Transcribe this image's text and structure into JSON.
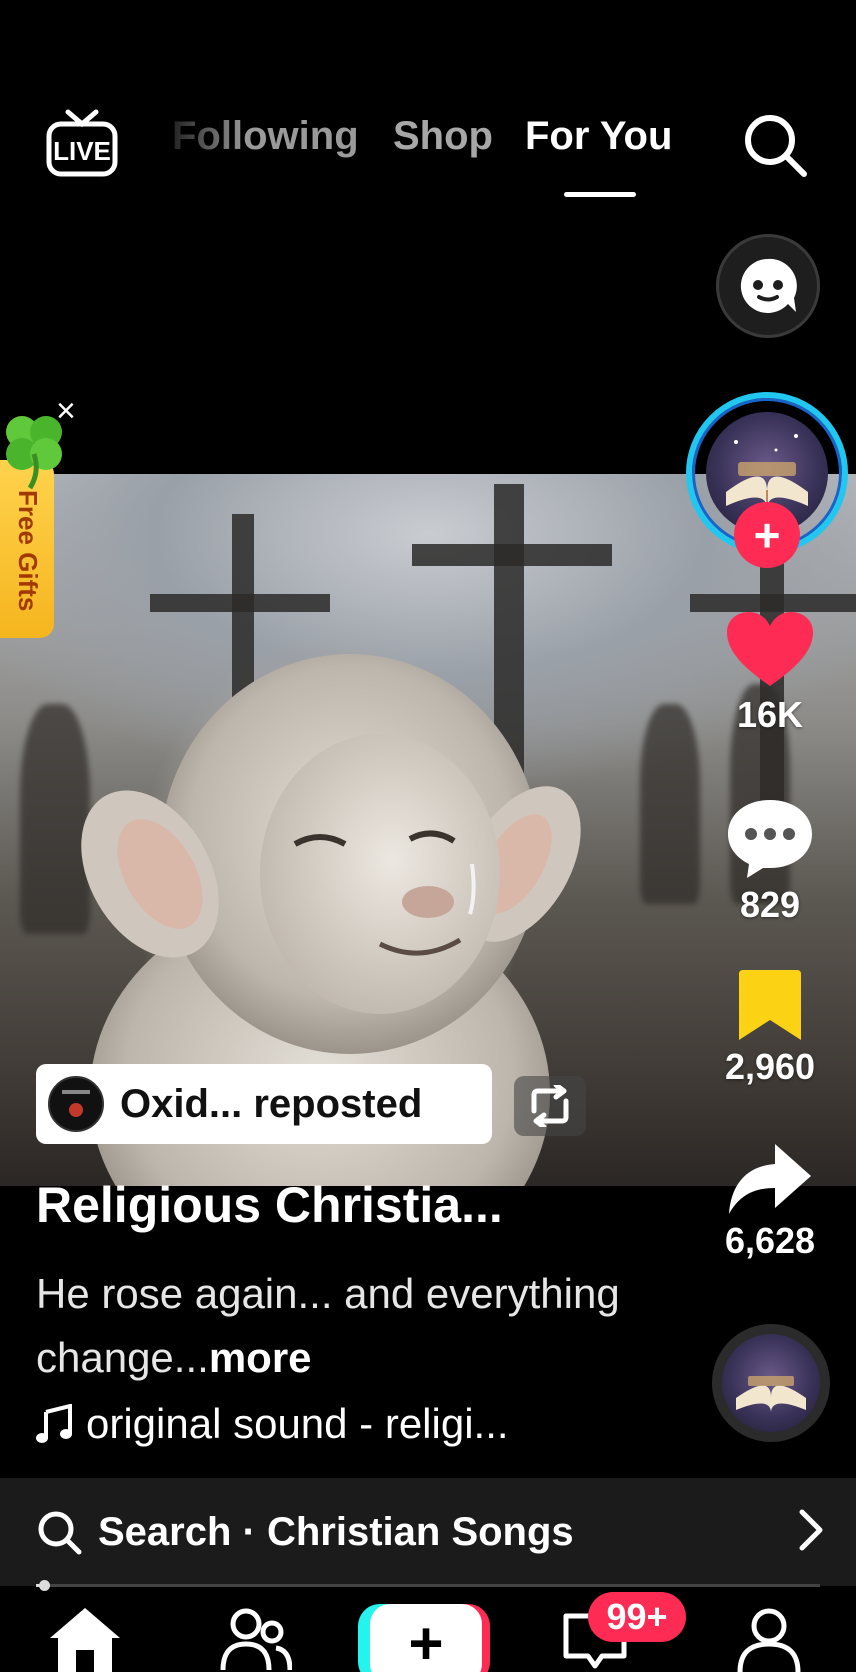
{
  "top_nav": {
    "live_label": "LIVE",
    "tabs": [
      {
        "label": "Following",
        "active": false
      },
      {
        "label": "Shop",
        "active": false
      },
      {
        "label": "For You",
        "active": true
      }
    ]
  },
  "promo": {
    "label": "Free Gifts",
    "close_glyph": "×"
  },
  "actions": {
    "follow_glyph": "+",
    "likes": "16K",
    "comments": "829",
    "saves": "2,960",
    "shares": "6,628"
  },
  "post": {
    "repost_text": "Oxid... reposted",
    "username": "Religious Christia...",
    "description": "He rose again... and everything change...",
    "more_label": "more",
    "sound": "original sound - religi..."
  },
  "search_suggestion": {
    "text": "Search · Christian Songs"
  },
  "playback": {
    "progress": 0.01
  },
  "bottom_nav": {
    "create_glyph": "+",
    "inbox_badge": "99+"
  },
  "colors": {
    "accent_red": "#fe2c55",
    "accent_cyan": "#25f4ee",
    "save_yellow": "#fbd214",
    "avatar_ring": "#21c7ee"
  },
  "icons": [
    "live-icon",
    "search-icon",
    "ai-chat-icon",
    "heart-icon",
    "comment-icon",
    "bookmark-icon",
    "share-icon",
    "repost-icon",
    "music-note-icon",
    "chevron-right-icon",
    "home-icon",
    "friends-icon",
    "inbox-icon",
    "profile-icon"
  ]
}
